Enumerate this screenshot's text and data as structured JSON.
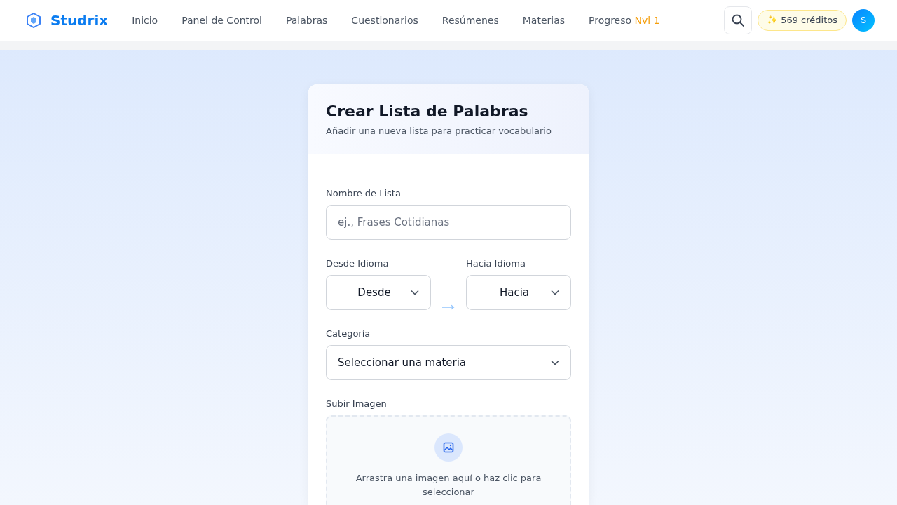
{
  "brand": {
    "name": "Studrix"
  },
  "nav": [
    {
      "label": "Inicio"
    },
    {
      "label": "Panel de Control"
    },
    {
      "label": "Palabras"
    },
    {
      "label": "Cuestionarios"
    },
    {
      "label": "Resúmenes"
    },
    {
      "label": "Materias"
    },
    {
      "label": "Progreso",
      "badge": "Nvl 1"
    }
  ],
  "credits": {
    "icon": "✨",
    "label": "569 créditos"
  },
  "avatar": {
    "initial": "S"
  },
  "form": {
    "title": "Crear Lista de Palabras",
    "subtitle": "Añadir una nueva lista para practicar vocabulario",
    "name_field": {
      "label": "Nombre de Lista",
      "placeholder": "ej., Frases Cotidianas"
    },
    "from_field": {
      "label": "Desde Idioma",
      "value": "Desde"
    },
    "to_field": {
      "label": "Hacia Idioma",
      "value": "Hacia"
    },
    "category_field": {
      "label": "Categoría",
      "value": "Seleccionar una materia"
    },
    "upload": {
      "label": "Subir Imagen",
      "hint": "Arrastra una imagen aquí o haz clic para seleccionar"
    }
  }
}
